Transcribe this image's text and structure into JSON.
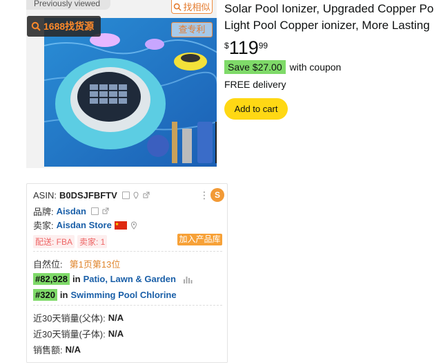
{
  "previously_viewed": "Previously viewed",
  "image_badges": {
    "source_1688": "1688找货源",
    "similar": "找相似",
    "patent": "查专利"
  },
  "product": {
    "title_line1": "Solar Pool Ionizer, Upgraded Copper Po",
    "title_line2": "Light Pool Copper ionizer, More Lasting",
    "price_currency": "$",
    "price_whole": "119",
    "price_fraction": "99",
    "save_badge": "Save $27.00",
    "coupon_text": "with coupon",
    "delivery": "FREE delivery",
    "add_to_cart": "Add to cart"
  },
  "panel": {
    "asin_label": "ASIN:",
    "asin_value": "B0DSJFBFTV",
    "brand_label": "品牌:",
    "brand_value": "Aisdan",
    "seller_label": "卖家:",
    "seller_value": "Aisdan Store",
    "fulfillment_tag": "配送: FBA",
    "sellers_tag": "卖家: 1",
    "add_library": "加入产品库",
    "organic_label": "自然位:",
    "organic_value": "第1页第13位",
    "rank1_value": "#82,928",
    "rank1_in": "in",
    "rank1_category": "Patio, Lawn & Garden",
    "rank2_value": "#320",
    "rank2_in": "in",
    "rank2_category": "Swimming Pool Chlorine",
    "sales30_parent_label": "近30天销量(父体):",
    "sales30_parent_value": "N/A",
    "sales30_child_label": "近30天销量(子体):",
    "sales30_child_value": "N/A",
    "revenue_label": "销售额:",
    "revenue_value": "N/A",
    "logo_letter": "S"
  },
  "colors": {
    "save_green": "#7fda69",
    "add_cart_yellow": "#ffd814",
    "orange": "#f7a137",
    "link_blue": "#1a5fa8"
  }
}
